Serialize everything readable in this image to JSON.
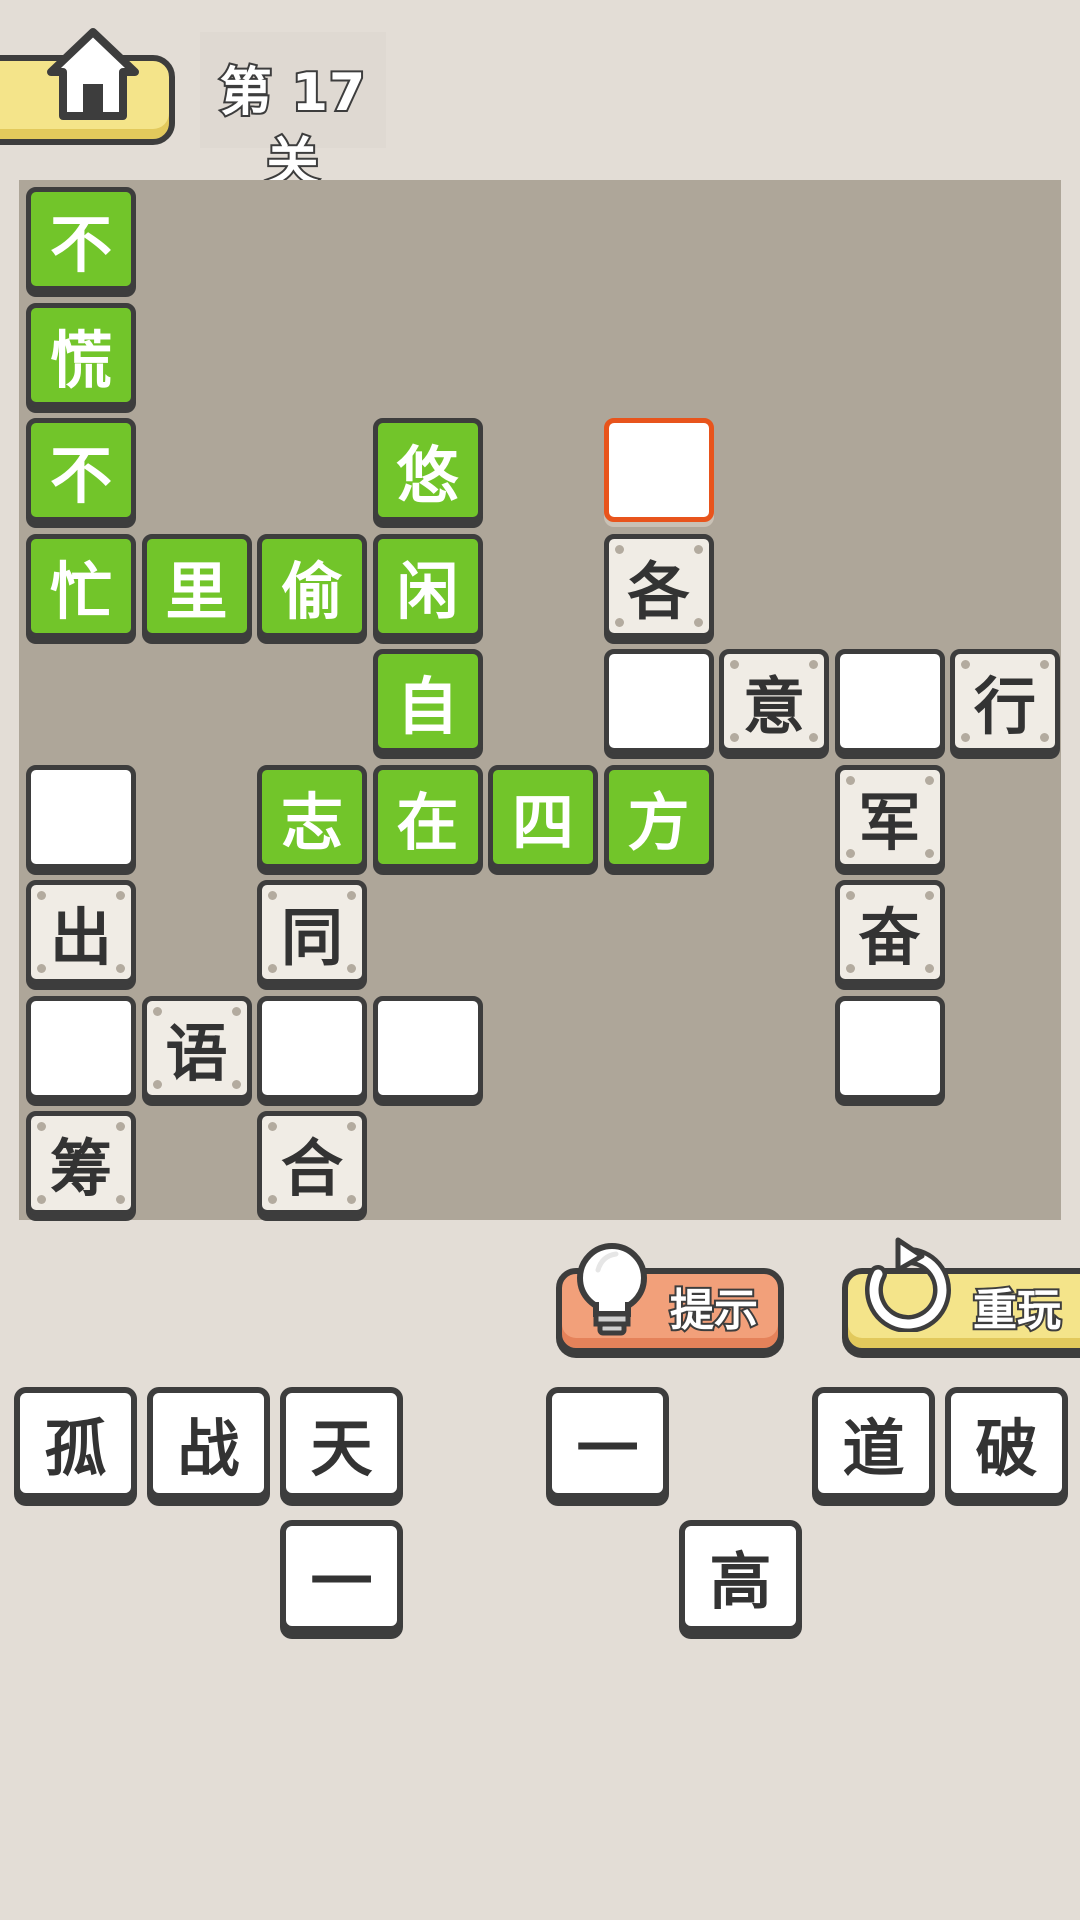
{
  "header": {
    "level_title": "第 17 关"
  },
  "board": {
    "rows": [
      [
        {
          "char": "不",
          "state": "solved"
        },
        {
          "char": "",
          "state": "none"
        },
        {
          "char": "",
          "state": "none"
        },
        {
          "char": "",
          "state": "none"
        },
        {
          "char": "",
          "state": "none"
        },
        {
          "char": "",
          "state": "none"
        },
        {
          "char": "",
          "state": "none"
        },
        {
          "char": "",
          "state": "none"
        },
        {
          "char": "",
          "state": "none"
        }
      ],
      [
        {
          "char": "慌",
          "state": "solved"
        },
        {
          "char": "",
          "state": "none"
        },
        {
          "char": "",
          "state": "none"
        },
        {
          "char": "",
          "state": "none"
        },
        {
          "char": "",
          "state": "none"
        },
        {
          "char": "",
          "state": "none"
        },
        {
          "char": "",
          "state": "none"
        },
        {
          "char": "",
          "state": "none"
        },
        {
          "char": "",
          "state": "none"
        }
      ],
      [
        {
          "char": "不",
          "state": "solved"
        },
        {
          "char": "",
          "state": "none"
        },
        {
          "char": "",
          "state": "none"
        },
        {
          "char": "悠",
          "state": "solved"
        },
        {
          "char": "",
          "state": "none"
        },
        {
          "char": "",
          "state": "selected"
        },
        {
          "char": "",
          "state": "none"
        },
        {
          "char": "",
          "state": "none"
        },
        {
          "char": "",
          "state": "none"
        }
      ],
      [
        {
          "char": "忙",
          "state": "solved"
        },
        {
          "char": "里",
          "state": "solved"
        },
        {
          "char": "偷",
          "state": "solved"
        },
        {
          "char": "闲",
          "state": "solved"
        },
        {
          "char": "",
          "state": "none"
        },
        {
          "char": "各",
          "state": "given"
        },
        {
          "char": "",
          "state": "none"
        },
        {
          "char": "",
          "state": "none"
        },
        {
          "char": "",
          "state": "none"
        }
      ],
      [
        {
          "char": "",
          "state": "none"
        },
        {
          "char": "",
          "state": "none"
        },
        {
          "char": "",
          "state": "none"
        },
        {
          "char": "自",
          "state": "solved"
        },
        {
          "char": "",
          "state": "none"
        },
        {
          "char": "",
          "state": "empty"
        },
        {
          "char": "意",
          "state": "given"
        },
        {
          "char": "",
          "state": "empty"
        },
        {
          "char": "行",
          "state": "given"
        }
      ],
      [
        {
          "char": "",
          "state": "empty"
        },
        {
          "char": "",
          "state": "none"
        },
        {
          "char": "志",
          "state": "solved"
        },
        {
          "char": "在",
          "state": "solved"
        },
        {
          "char": "四",
          "state": "solved"
        },
        {
          "char": "方",
          "state": "solved"
        },
        {
          "char": "",
          "state": "none"
        },
        {
          "char": "军",
          "state": "given"
        },
        {
          "char": "",
          "state": "none"
        }
      ],
      [
        {
          "char": "出",
          "state": "given"
        },
        {
          "char": "",
          "state": "none"
        },
        {
          "char": "同",
          "state": "given"
        },
        {
          "char": "",
          "state": "none"
        },
        {
          "char": "",
          "state": "none"
        },
        {
          "char": "",
          "state": "none"
        },
        {
          "char": "",
          "state": "none"
        },
        {
          "char": "奋",
          "state": "given"
        },
        {
          "char": "",
          "state": "none"
        }
      ],
      [
        {
          "char": "",
          "state": "empty"
        },
        {
          "char": "语",
          "state": "given"
        },
        {
          "char": "",
          "state": "empty"
        },
        {
          "char": "",
          "state": "empty"
        },
        {
          "char": "",
          "state": "none"
        },
        {
          "char": "",
          "state": "none"
        },
        {
          "char": "",
          "state": "none"
        },
        {
          "char": "",
          "state": "empty"
        },
        {
          "char": "",
          "state": "none"
        }
      ],
      [
        {
          "char": "筹",
          "state": "given"
        },
        {
          "char": "",
          "state": "none"
        },
        {
          "char": "合",
          "state": "given"
        },
        {
          "char": "",
          "state": "none"
        },
        {
          "char": "",
          "state": "none"
        },
        {
          "char": "",
          "state": "none"
        },
        {
          "char": "",
          "state": "none"
        },
        {
          "char": "",
          "state": "none"
        },
        {
          "char": "",
          "state": "none"
        }
      ]
    ]
  },
  "actions": {
    "hint_label": "提示",
    "replay_label": "重玩"
  },
  "candidates": {
    "row1": [
      "孤",
      "战",
      "天",
      "",
      "一",
      "",
      "道",
      "破"
    ],
    "row2": [
      "",
      "",
      "一",
      "",
      "",
      "高",
      "",
      ""
    ]
  },
  "colors": {
    "background": "#e3ddd6",
    "board": "#aea699",
    "solved_tile": "#72c52a",
    "given_tile": "#f0ece5",
    "selected_border": "#e8541c",
    "hint_button": "#f2a07a",
    "replay_button": "#f4e48a",
    "outline": "#3d3d3d"
  }
}
